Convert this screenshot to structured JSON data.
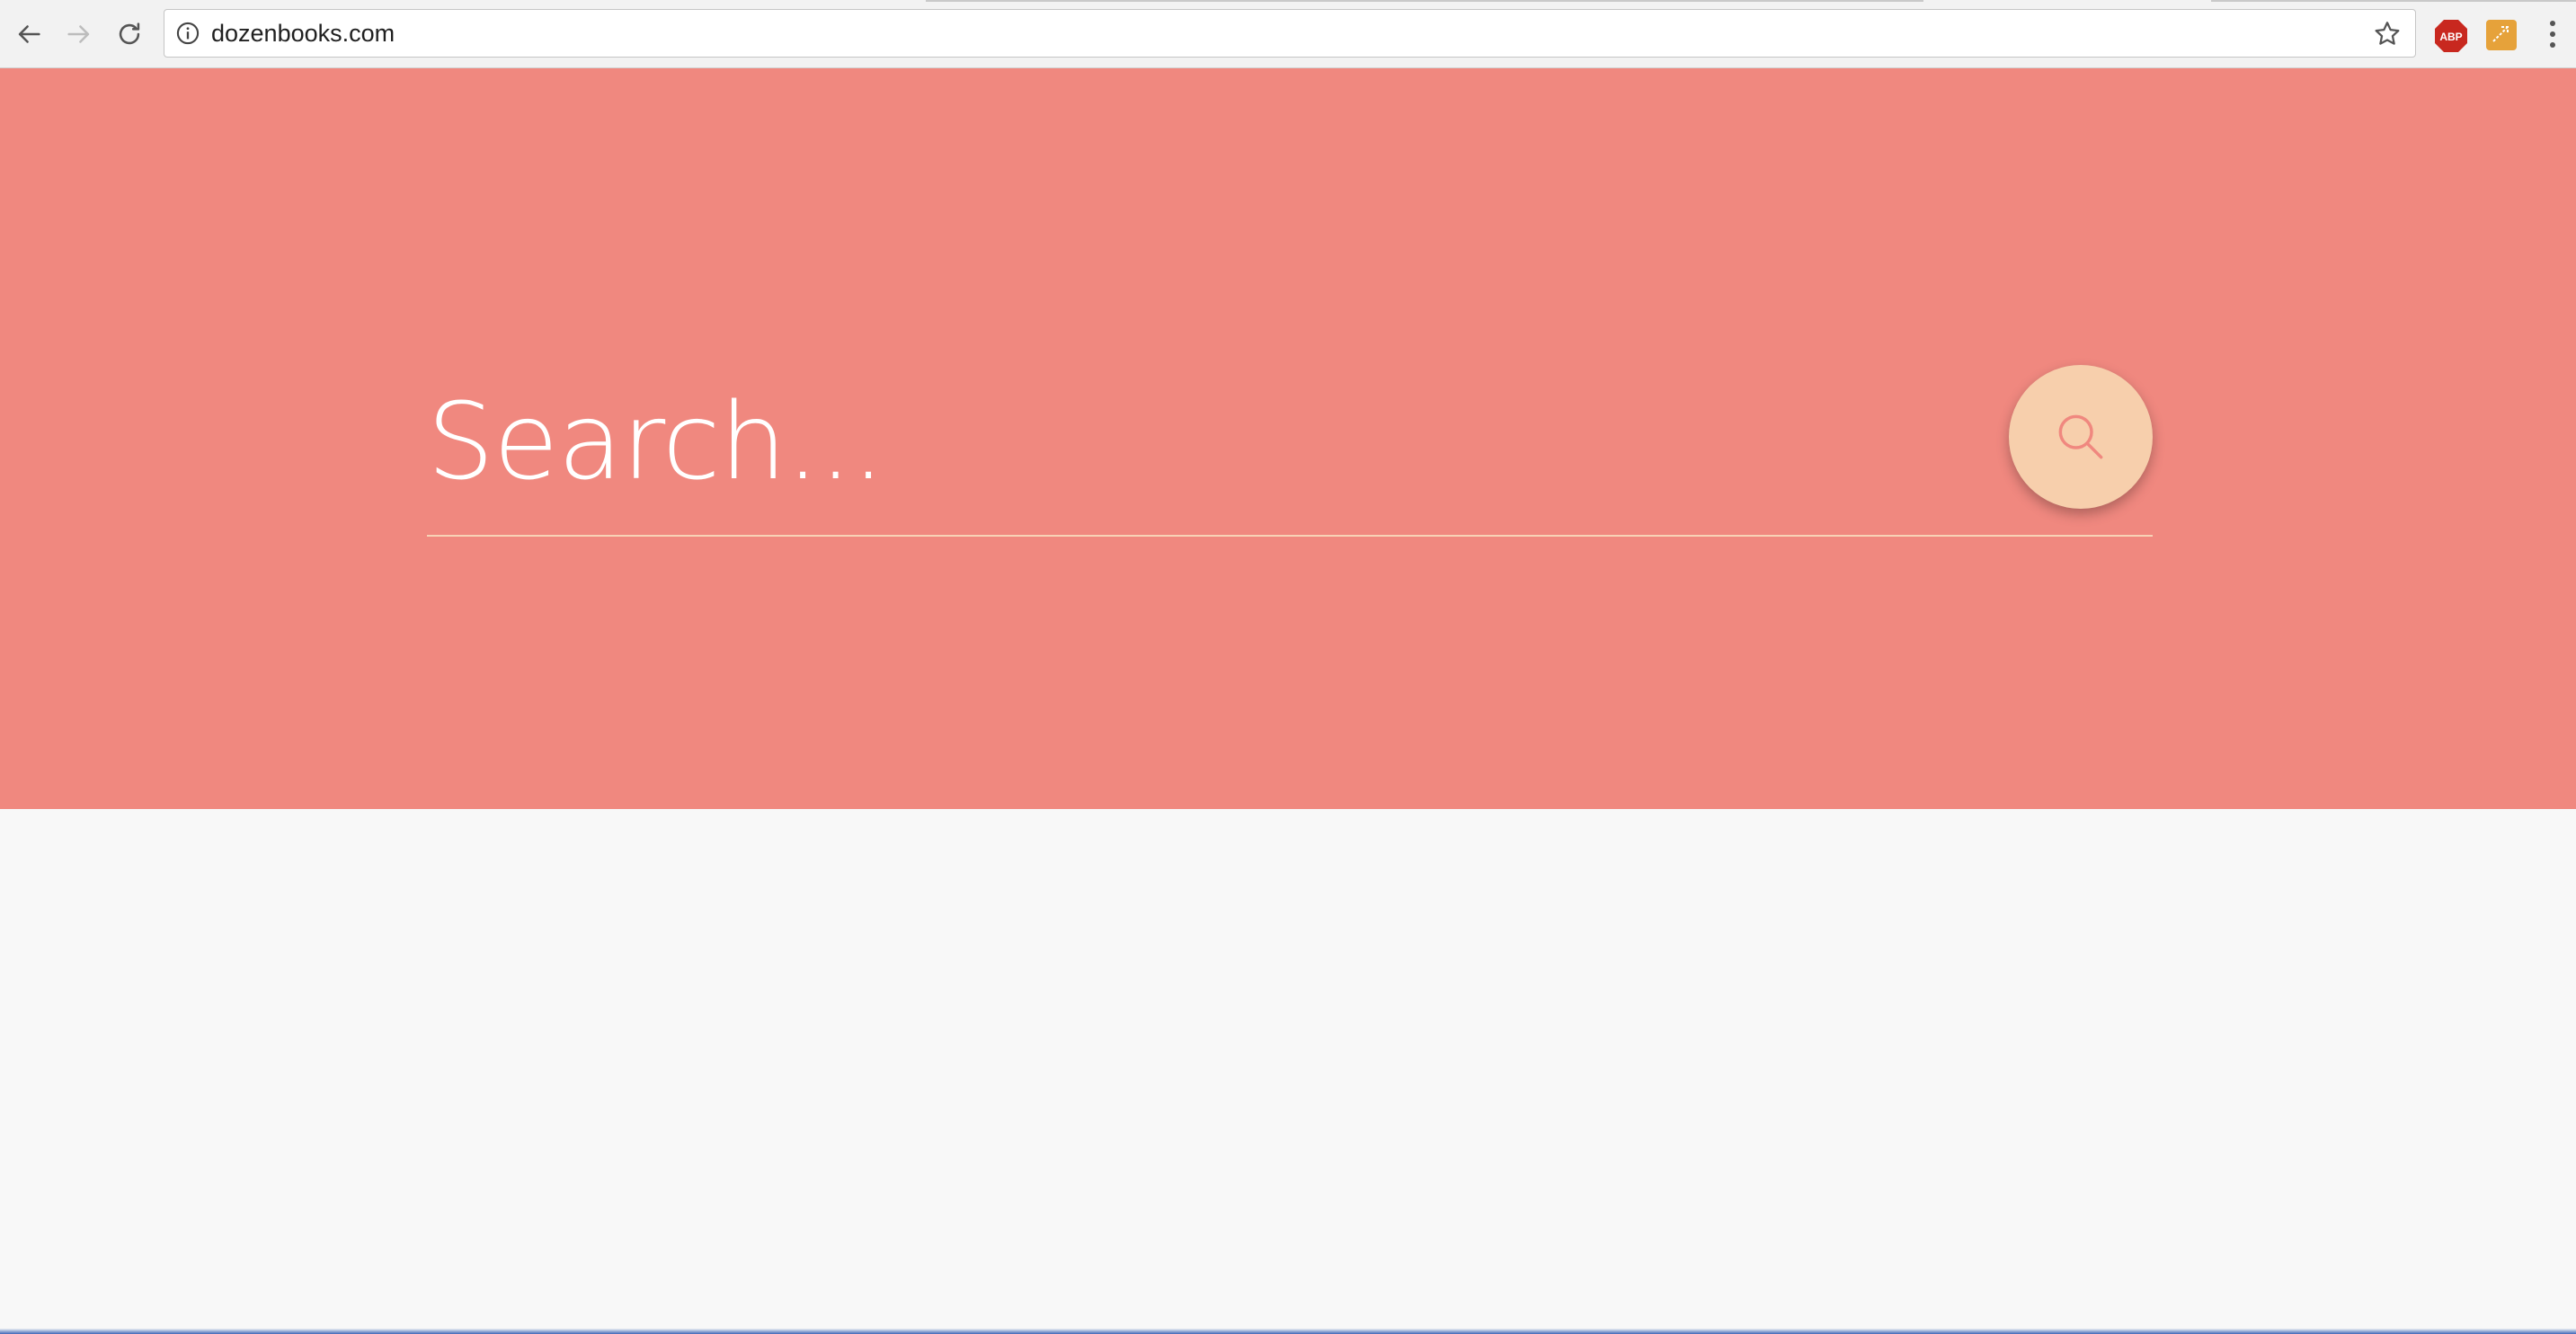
{
  "browser": {
    "url": "dozenbooks.com",
    "icons": {
      "back": "arrow-left-icon",
      "forward": "arrow-right-icon",
      "reload": "reload-icon",
      "info": "info-icon",
      "bookmark": "star-icon",
      "adblock": "adblock-icon",
      "extension": "extension-icon",
      "menu": "menu-dots-icon"
    },
    "adblock_label": "ABP"
  },
  "hero": {
    "background_color": "#f0887f",
    "search_placeholder": "Search...",
    "search_value": "",
    "search_button_icon": "search-icon",
    "button_color": "#f7cfac"
  },
  "page": {
    "background_color": "#f8f8f8"
  }
}
